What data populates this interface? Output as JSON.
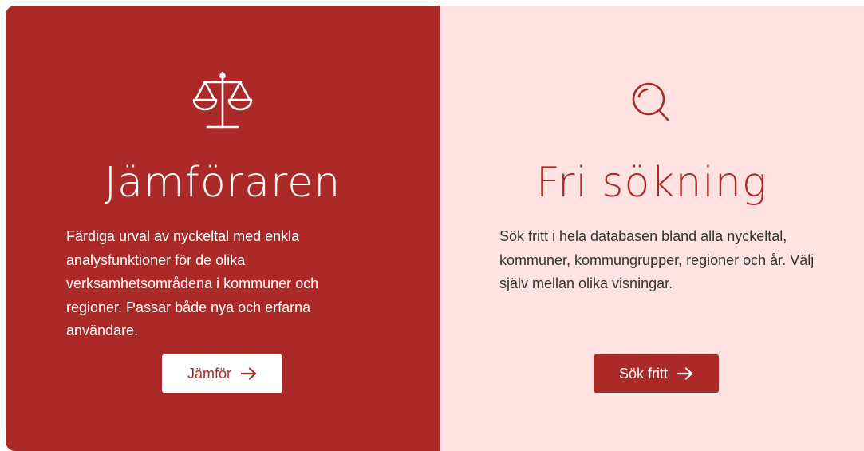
{
  "colors": {
    "brand_red": "#ab2926",
    "light_pink": "#ffe2e2",
    "white": "#ffffff",
    "body_text": "#333333"
  },
  "compare_card": {
    "icon": "scales-icon",
    "title": "Jämföraren",
    "description": "Färdiga urval av nyckeltal med enkla analysfunktioner för de olika verksamhetsområdena i kommuner och regioner. Passar både nya och erfarna användare.",
    "button_label": "Jämför",
    "button_icon": "arrow-right-icon"
  },
  "search_card": {
    "icon": "search-icon",
    "title": "Fri sökning",
    "description": "Sök fritt i hela databasen bland alla nyckeltal, kommuner, kommungrupper, regioner och år. Välj själv mellan olika visningar.",
    "button_label": "Sök fritt",
    "button_icon": "arrow-right-icon"
  }
}
